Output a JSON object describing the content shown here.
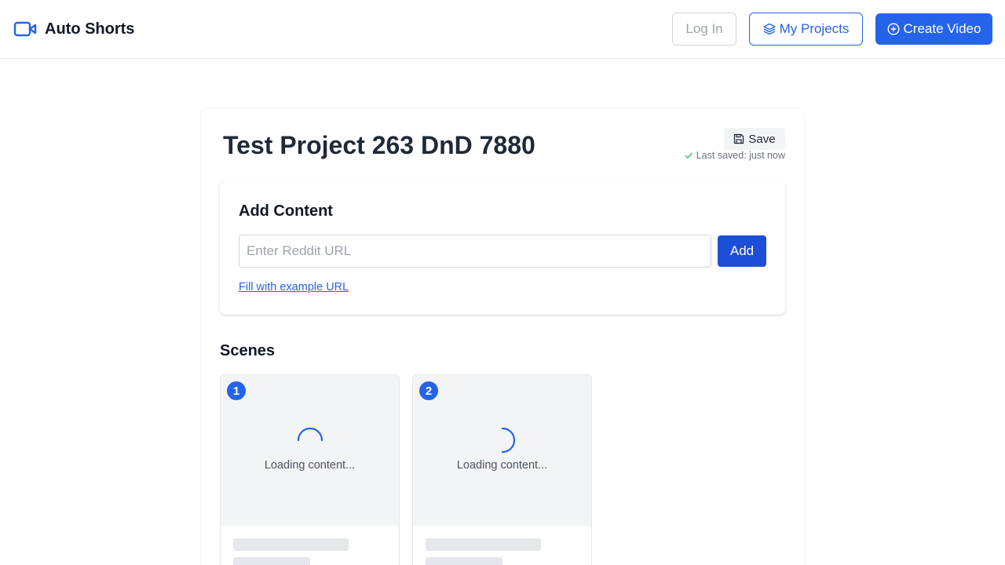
{
  "header": {
    "brand": "Auto Shorts",
    "login_label": "Log In",
    "projects_label": "My Projects",
    "create_label": "Create Video"
  },
  "project": {
    "title": "Test Project 263 DnD 7880",
    "save_label": "Save",
    "last_saved": "Last saved: just now"
  },
  "add_content": {
    "title": "Add Content",
    "placeholder": "Enter Reddit URL",
    "value": "",
    "add_label": "Add",
    "example_link": "Fill with example URL"
  },
  "scenes": {
    "title": "Scenes",
    "items": [
      {
        "number": "1",
        "status": "Loading content..."
      },
      {
        "number": "2",
        "status": "Loading content..."
      }
    ]
  },
  "colors": {
    "accent": "#2563eb",
    "accent_dark": "#1d4ed8",
    "success": "#22c55e"
  }
}
